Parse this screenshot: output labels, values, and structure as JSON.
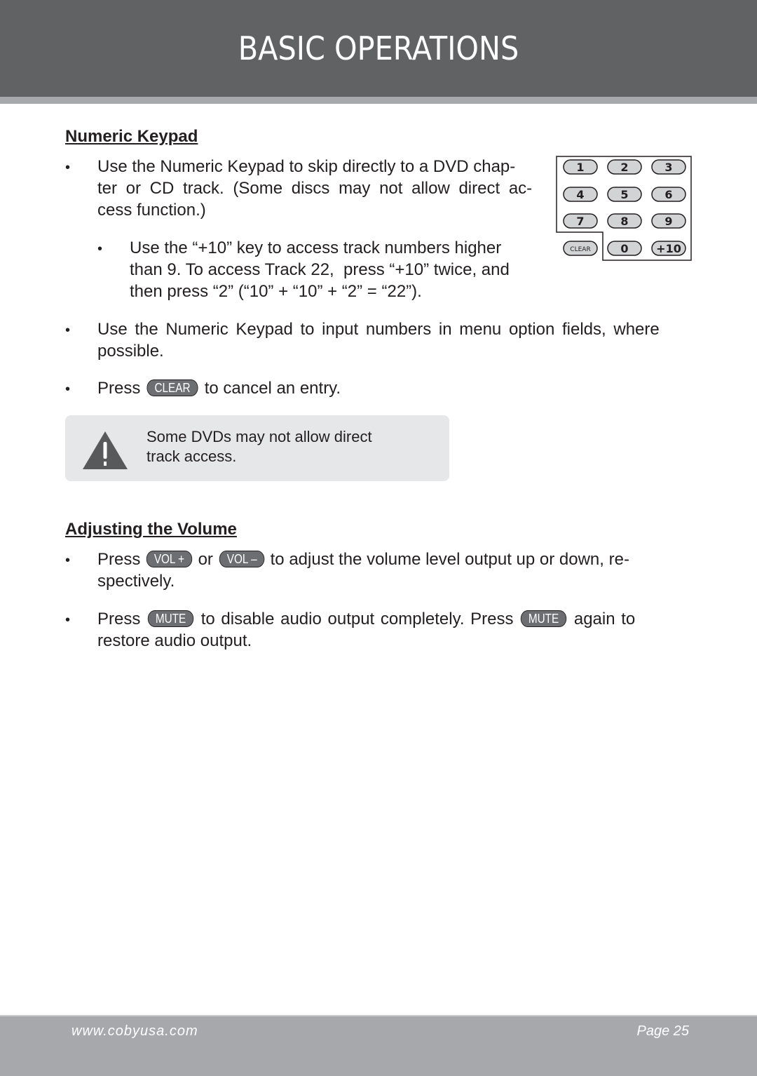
{
  "header": {
    "title": "BASIC OPERATIONS"
  },
  "numeric_keypad": {
    "heading": "Numeric Keypad",
    "bullet_1": {
      "lines": [
        "Use the Numeric Keypad to skip directly to a DVD chap-",
        "ter or CD track. (Some discs may not allow direct ac-",
        "cess function.)"
      ]
    },
    "sub_bullet": {
      "lines": [
        "Use the “+10” key to access track numbers higher",
        "than 9. To access Track 22,  press “+10” twice, and",
        "then press “2” (“10” + “10” + “2” = “22”)."
      ]
    },
    "bullet_2": {
      "lines": [
        "Use the Numeric Keypad to input numbers in menu option fields, where",
        "possible."
      ]
    },
    "bullet_3": {
      "before": "Press",
      "button": "CLEAR",
      "after": "to cancel an entry."
    },
    "keypad_keys": [
      "1",
      "2",
      "3",
      "4",
      "5",
      "6",
      "7",
      "8",
      "9",
      "CLEAR",
      "0",
      "+10"
    ],
    "note": {
      "icon": "warning-icon",
      "lines": [
        "Some DVDs may not allow direct",
        "track access."
      ]
    }
  },
  "volume": {
    "heading": "Adjusting the Volume",
    "bullet_1": {
      "before": "Press",
      "button_1": "VOL +",
      "middle": "or",
      "button_2": "VOL –",
      "after": "to adjust the volume level output up or down, re-",
      "line_2": "spectively."
    },
    "bullet_2": {
      "before": "Press",
      "button_1": "MUTE",
      "middle": "to disable audio output completely. Press",
      "button_2": "MUTE",
      "after": "again to",
      "line_2": "restore audio output."
    }
  },
  "bullet_char": "•",
  "footer": {
    "url": "www.cobyusa.com",
    "page": "Page 25"
  }
}
